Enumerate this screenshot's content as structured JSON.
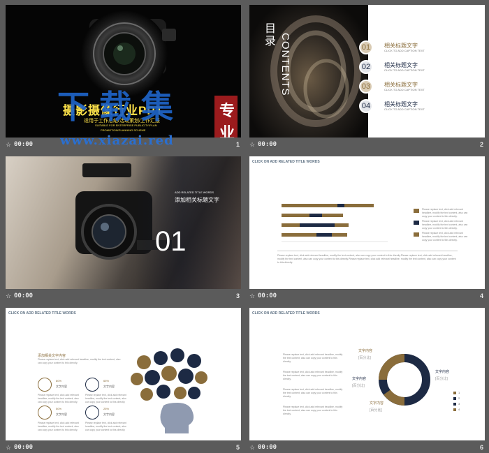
{
  "watermark": {
    "big": "下载集",
    "url": "www.xiazai.red"
  },
  "slides": [
    {
      "number": "1",
      "duration": "00:00",
      "title": "摄影摄像行业PPT",
      "subtitle": "适用于工作总结/活动策划/工作汇报",
      "subtitle_en1": "SUITABLE FOR ENTERPRISE PUBLICITY/PLAN",
      "subtitle_en2": "PROMOTION/PLANNING SCHEME",
      "seal": [
        "专",
        "业"
      ]
    },
    {
      "number": "2",
      "duration": "00:00",
      "heading": "目录",
      "heading_en": "CONTENTS",
      "items": [
        {
          "num": "01",
          "label": "相关标题文字",
          "caption": "CLICK TO ADD CAPTION TEXT",
          "color": "#8a6d3b"
        },
        {
          "num": "02",
          "label": "相关标题文字",
          "caption": "CLICK TO ADD CAPTION TEXT",
          "color": "#1d2a44"
        },
        {
          "num": "03",
          "label": "相关标题文字",
          "caption": "CLICK TO ADD CAPTION TEXT",
          "color": "#8a6d3b"
        },
        {
          "num": "04",
          "label": "相关标题文字",
          "caption": "CLICK TO ADD CAPTION TEXT",
          "color": "#1d2a44"
        }
      ]
    },
    {
      "number": "3",
      "duration": "00:00",
      "caption": "ADD RELATED TITLE WORDS",
      "label": "添加相关标题文字",
      "section": "01"
    },
    {
      "number": "4",
      "duration": "00:00",
      "header": "CLICK ON ADD RELATED TITLE WORDS",
      "paragraph": "Please replace text, click add relevant headline, modify the text content, also can copy your content to this directly.Please replace text, click add relevant headline, modify the text content, also can copy your content to this directly.Please replace text, click add relevant headline, modify the text content, also can copy your content to this directly.",
      "legend": [
        "Please replace text, click add relevant headline, modify the text content, also can copy your content to this directly.",
        "Please replace text, click add relevant headline, modify the text content, also can copy your content to this directly.",
        "Please replace text, click add relevant headline, modify the text content, also can copy your content to this directly."
      ]
    },
    {
      "number": "5",
      "duration": "00:00",
      "header": "CLICK ON ADD RELATED TITLE WORDS",
      "title": "添加相关文字内容",
      "intro": "Please replace text, click add relevant headline, modify the text content, also can copy your content to this directly.",
      "stats": [
        {
          "pct": "80%",
          "label": "文字内容",
          "text": "Please replace text, click add relevant headline, modify the text content, also can copy your content to this directly."
        },
        {
          "pct": "65%",
          "label": "文字内容",
          "text": "Please replace text, click add relevant headline, modify the text content, also can copy your content to this directly."
        },
        {
          "pct": "50%",
          "label": "文字内容",
          "text": "Please replace text, click add relevant headline, modify the text content, also can copy your content to this directly."
        },
        {
          "pct": "25%",
          "label": "文字内容",
          "text": "Please replace text, click add relevant headline, modify the text content, also can copy your content to this directly."
        }
      ]
    },
    {
      "number": "6",
      "duration": "00:00",
      "header": "CLICK ON ADD RELATED TITLE WORDS",
      "labels": [
        {
          "title": "文字内容",
          "sub": "[百分比]"
        },
        {
          "title": "文字内容",
          "sub": "[百分比]"
        },
        {
          "title": "文字内容",
          "sub": "[百分比]"
        },
        {
          "title": "文字内容",
          "sub": "[百分比]"
        }
      ],
      "paragraph": "Please replace text, click add relevant headline, modify the text content, also can copy your content to this directly.",
      "legend_keys": [
        "1",
        "2",
        "3",
        "4"
      ]
    }
  ],
  "colors": {
    "gold": "#8a6d3b",
    "navy": "#1d2a44",
    "tan": "#a08868"
  }
}
